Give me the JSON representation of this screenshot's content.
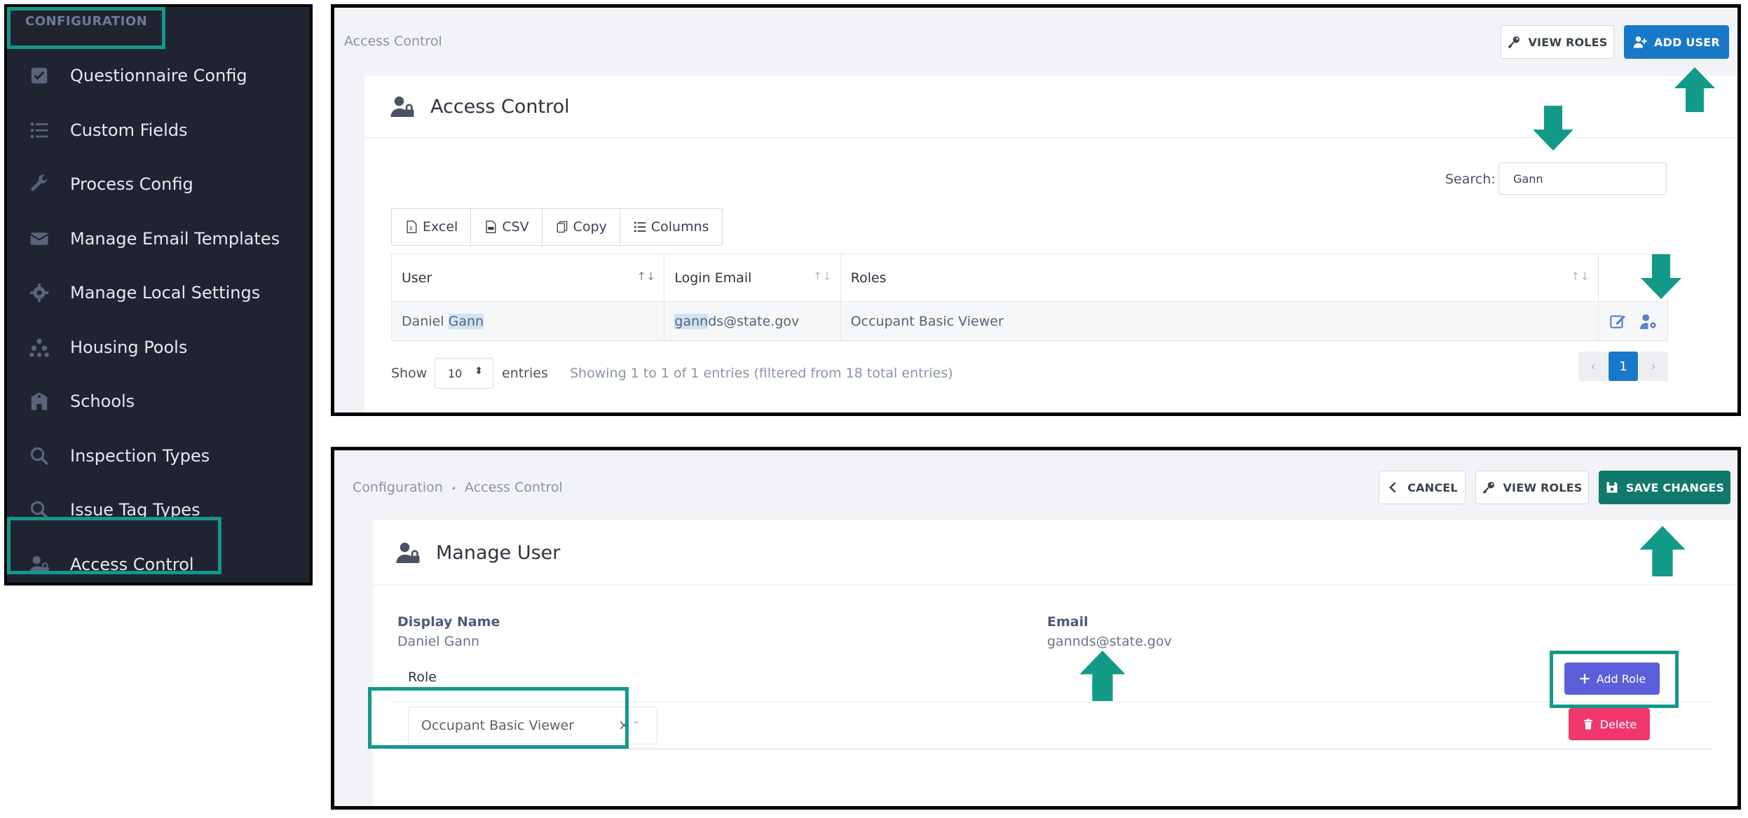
{
  "sidebar": {
    "header": "CONFIGURATION",
    "items": [
      {
        "label": "Questionnaire Config",
        "icon": "checkbox-icon"
      },
      {
        "label": "Custom Fields",
        "icon": "list-icon"
      },
      {
        "label": "Process Config",
        "icon": "wrench-icon"
      },
      {
        "label": "Manage Email Templates",
        "icon": "envelope-icon"
      },
      {
        "label": "Manage Local Settings",
        "icon": "gear-icon"
      },
      {
        "label": "Housing Pools",
        "icon": "pool-dots-icon"
      },
      {
        "label": "Schools",
        "icon": "school-icon"
      },
      {
        "label": "Inspection Types",
        "icon": "magnifier-icon"
      },
      {
        "label": "Issue Tag Types",
        "icon": "magnifier-icon"
      },
      {
        "label": "Access Control",
        "icon": "user-lock-icon"
      }
    ]
  },
  "access_control": {
    "breadcrumb": "Access Control",
    "view_roles_label": "VIEW ROLES",
    "add_user_label": "ADD USER",
    "title": "Access Control",
    "search_label": "Search:",
    "search_value": "Gann",
    "export_buttons": [
      "Excel",
      "CSV",
      "Copy",
      "Columns"
    ],
    "columns": [
      "User",
      "Login Email",
      "Roles"
    ],
    "row": {
      "user_first": "Daniel ",
      "user_match": "Gann",
      "email_match": "gann",
      "email_rest": "ds@state.gov",
      "roles": "Occupant Basic Viewer"
    },
    "show_label": "Show",
    "page_length": "10",
    "entries_label": "entries",
    "info": "Showing 1 to 1 of 1 entries (filtered from 18 total entries)",
    "pagination": {
      "current": "1",
      "prev": "‹",
      "next": "›"
    }
  },
  "manage_user": {
    "breadcrumb_root": "Configuration",
    "breadcrumb_sep": "•",
    "breadcrumb_current": "Access Control",
    "cancel_label": "CANCEL",
    "view_roles_label": "VIEW ROLES",
    "save_label": "SAVE CHANGES",
    "title": "Manage User",
    "display_name_label": "Display Name",
    "display_name_value": "Daniel Gann",
    "email_label": "Email",
    "email_value": "gannds@state.gov",
    "role_label": "Role",
    "role_value": "Occupant Basic Viewer",
    "role_clear": "×",
    "add_role_label": "Add Role",
    "delete_label": "Delete"
  },
  "colors": {
    "highlight": "#13988a",
    "arrow": "#129a87",
    "sidebar_bg": "#202431",
    "primary_blue": "#1a78c9",
    "save_teal": "#10796b",
    "add_role": "#5b5fd9",
    "delete": "#f0386f"
  }
}
